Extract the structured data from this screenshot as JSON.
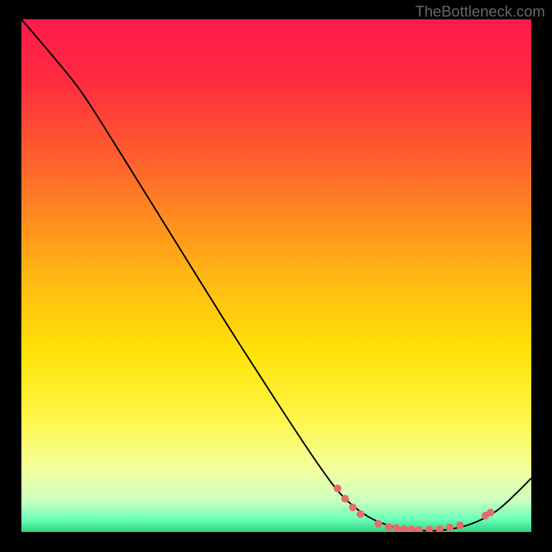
{
  "attribution": "TheBottleneck.com",
  "chart_data": {
    "type": "line",
    "title": "",
    "xlabel": "",
    "ylabel": "",
    "xlim": [
      0,
      100
    ],
    "ylim": [
      0,
      100
    ],
    "gradient_stops": [
      {
        "pos": 0.0,
        "color": "#ff1a4a"
      },
      {
        "pos": 0.12,
        "color": "#ff2b3f"
      },
      {
        "pos": 0.3,
        "color": "#ff6a2a"
      },
      {
        "pos": 0.5,
        "color": "#ffb712"
      },
      {
        "pos": 0.65,
        "color": "#ffe308"
      },
      {
        "pos": 0.78,
        "color": "#fff64a"
      },
      {
        "pos": 0.88,
        "color": "#f3ffa0"
      },
      {
        "pos": 0.94,
        "color": "#c9ffc0"
      },
      {
        "pos": 0.975,
        "color": "#6bffb8"
      },
      {
        "pos": 1.0,
        "color": "#2fd37f"
      }
    ],
    "curve": [
      {
        "x": 0,
        "y": 100
      },
      {
        "x": 6,
        "y": 93
      },
      {
        "x": 12,
        "y": 85.5
      },
      {
        "x": 20,
        "y": 73
      },
      {
        "x": 30,
        "y": 57
      },
      {
        "x": 40,
        "y": 41
      },
      {
        "x": 50,
        "y": 25.5
      },
      {
        "x": 58,
        "y": 13.5
      },
      {
        "x": 63,
        "y": 7
      },
      {
        "x": 68,
        "y": 3
      },
      {
        "x": 73,
        "y": 1
      },
      {
        "x": 78,
        "y": 0.3
      },
      {
        "x": 83,
        "y": 0.4
      },
      {
        "x": 88,
        "y": 1.5
      },
      {
        "x": 93,
        "y": 4
      },
      {
        "x": 97,
        "y": 7.5
      },
      {
        "x": 100,
        "y": 10.5
      }
    ],
    "markers": [
      {
        "x": 62,
        "y": 8.5
      },
      {
        "x": 63.5,
        "y": 6.5
      },
      {
        "x": 65,
        "y": 4.8
      },
      {
        "x": 66.5,
        "y": 3.5
      },
      {
        "x": 70,
        "y": 1.6
      },
      {
        "x": 72,
        "y": 1.0
      },
      {
        "x": 73.5,
        "y": 0.8
      },
      {
        "x": 75,
        "y": 0.6
      },
      {
        "x": 76.5,
        "y": 0.5
      },
      {
        "x": 78,
        "y": 0.4
      },
      {
        "x": 80,
        "y": 0.5
      },
      {
        "x": 82,
        "y": 0.6
      },
      {
        "x": 84,
        "y": 0.9
      },
      {
        "x": 86,
        "y": 1.3
      },
      {
        "x": 91,
        "y": 3.2
      },
      {
        "x": 92,
        "y": 3.8
      }
    ],
    "marker_color": "#e86b6b",
    "curve_color": "#000000"
  }
}
